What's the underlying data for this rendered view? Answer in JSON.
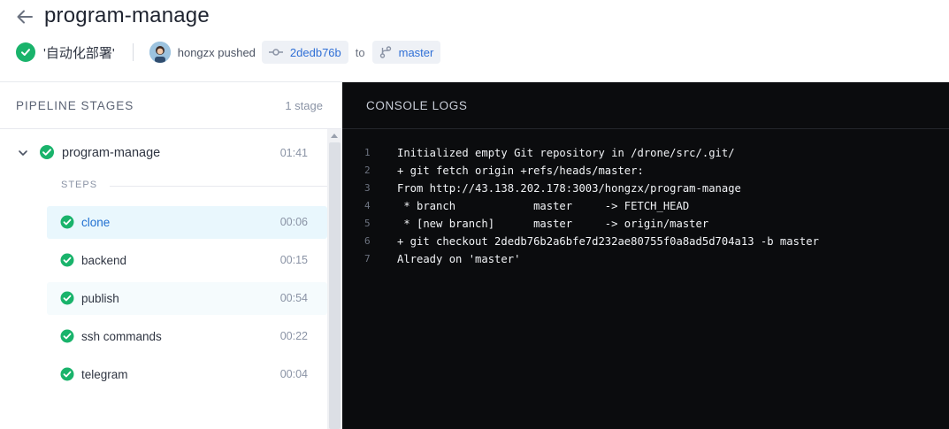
{
  "header": {
    "title": "program-manage",
    "commit_message": "'自动化部署'",
    "pusher": "hongzx pushed",
    "commit_sha": "2dedb76b",
    "to_label": "to",
    "branch": "master"
  },
  "pipeline": {
    "title": "PIPELINE STAGES",
    "stage_count": "1 stage",
    "stage": {
      "name": "program-manage",
      "duration": "01:41"
    },
    "steps_label": "STEPS",
    "steps": [
      {
        "name": "clone",
        "duration": "00:06"
      },
      {
        "name": "backend",
        "duration": "00:15"
      },
      {
        "name": "publish",
        "duration": "00:54"
      },
      {
        "name": "ssh commands",
        "duration": "00:22"
      },
      {
        "name": "telegram",
        "duration": "00:04"
      }
    ]
  },
  "console": {
    "title": "CONSOLE LOGS",
    "lines": [
      {
        "n": "1",
        "text": "Initialized empty Git repository in /drone/src/.git/"
      },
      {
        "n": "2",
        "text": "+ git fetch origin +refs/heads/master:"
      },
      {
        "n": "3",
        "text": "From http://43.138.202.178:3003/hongzx/program-manage"
      },
      {
        "n": "4",
        "text": " * branch            master     -> FETCH_HEAD"
      },
      {
        "n": "5",
        "text": " * [new branch]      master     -> origin/master"
      },
      {
        "n": "6",
        "text": "+ git checkout 2dedb76b2a6bfe7d232ae80755f0a8ad5d704a13 -b master"
      },
      {
        "n": "7",
        "text": "Already on 'master'"
      }
    ]
  },
  "colors": {
    "success": "#19b36b",
    "link": "#2f6fd6",
    "console_bg": "#0b0c0e"
  }
}
